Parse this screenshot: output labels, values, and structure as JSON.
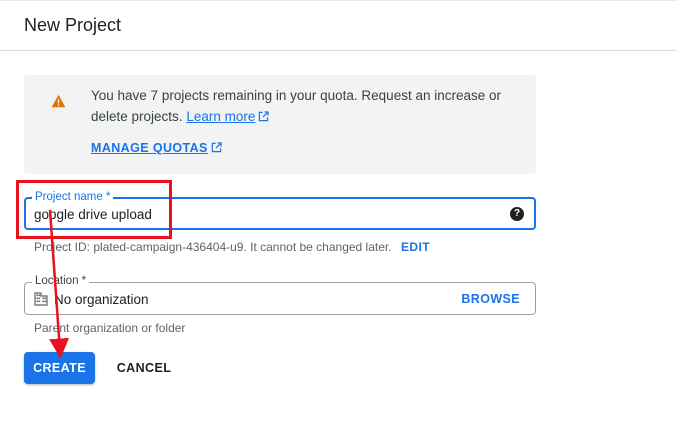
{
  "header": {
    "title": "New Project"
  },
  "quota": {
    "message": "You have 7 projects remaining in your quota. Request an increase or delete projects.",
    "learn_more": "Learn more",
    "manage_quotas": "MANAGE QUOTAS",
    "icon": "warning-icon"
  },
  "project_name": {
    "label": "Project name *",
    "value": "google drive upload",
    "help_icon": "help-icon"
  },
  "project_id": {
    "text": "Project ID: plated-campaign-436404-u9. It cannot be changed later.",
    "edit_label": "EDIT"
  },
  "location": {
    "label": "Location *",
    "value": "No organization",
    "browse_label": "BROWSE",
    "hint": "Parent organization or folder",
    "icon": "building-icon"
  },
  "actions": {
    "create_label": "CREATE",
    "cancel_label": "CANCEL"
  },
  "colors": {
    "accent": "#1a73e8",
    "warning": "#e37400",
    "annotation": "#e8121f"
  }
}
